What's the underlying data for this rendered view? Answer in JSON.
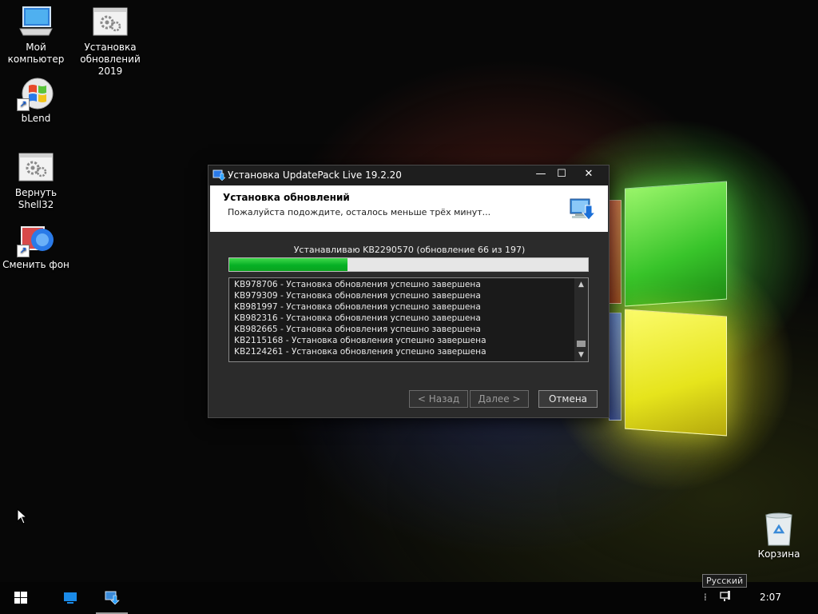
{
  "desktop": {
    "icons": [
      {
        "label": "Мой компьютер"
      },
      {
        "label": "Установка обновлений 2019"
      },
      {
        "label": "bLend"
      },
      {
        "label": "Вернуть Shell32"
      },
      {
        "label": "Сменить фон"
      },
      {
        "label": "Корзина"
      }
    ]
  },
  "dialog": {
    "title": "Установка UpdatePack Live 19.2.20",
    "controls": {
      "minimize": "—",
      "maximize": "☐",
      "close": "✕"
    },
    "header_title": "Установка обновлений",
    "header_subtitle": "Пожалуйста подождите, осталось меньше трёх минут...",
    "status": "Устанавливаю KB2290570 (обновление 66 из 197)",
    "progress_fraction": 0.33,
    "log": [
      "KB978706 - Установка обновления успешно завершена",
      "KB979309 - Установка обновления успешно завершена",
      "KB981997 - Установка обновления успешно завершена",
      "KB982316 - Установка обновления успешно завершена",
      "KB982665 - Установка обновления успешно завершена",
      "KB2115168 - Установка обновления успешно завершена",
      "KB2124261 - Установка обновления успешно завершена"
    ],
    "buttons": {
      "back": "< Назад",
      "next": "Далее >",
      "cancel": "Отмена"
    }
  },
  "taskbar": {
    "tooltip": "Русский",
    "clock": "2:07",
    "colors": {
      "progress": "#06b025",
      "accent": "#1a6fd8"
    }
  }
}
